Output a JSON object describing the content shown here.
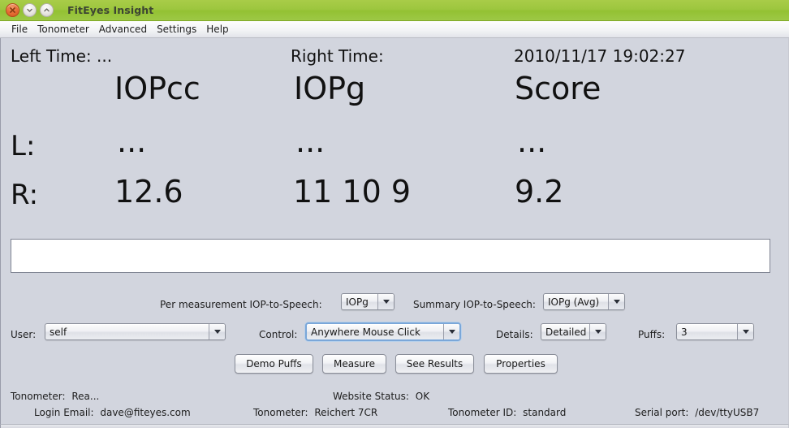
{
  "window": {
    "title": "FitEyes Insight",
    "controls": [
      {
        "name": "close",
        "icon": "close-icon"
      },
      {
        "name": "minimize",
        "icon": "chevron-down-icon"
      },
      {
        "name": "maximize",
        "icon": "chevron-up-icon"
      }
    ],
    "titlebar_color": "#9cc63e"
  },
  "menubar": {
    "items": [
      {
        "label": "File"
      },
      {
        "label": "Tonometer"
      },
      {
        "label": "Advanced"
      },
      {
        "label": "Settings"
      },
      {
        "label": "Help"
      }
    ]
  },
  "readings": {
    "left_time_label": "Left Time:",
    "left_time_value": "...",
    "right_time_label": "Right Time:",
    "right_time_value": "",
    "timestamp": "2010/11/17 19:02:27",
    "columns": [
      {
        "header": "IOPcc"
      },
      {
        "header": "IOPg"
      },
      {
        "header": "Score"
      }
    ],
    "rows": [
      {
        "label": "L:",
        "values": [
          "...",
          "...",
          "..."
        ]
      },
      {
        "label": "R:",
        "values": [
          "12.6",
          "11 10 9",
          "9.2"
        ]
      }
    ]
  },
  "log_field": {
    "value": "",
    "placeholder": ""
  },
  "speech_settings": {
    "per_measurement_label": "Per measurement IOP-to-Speech:",
    "per_measurement_value": "IOPg",
    "summary_label": "Summary IOP-to-Speech:",
    "summary_value": "IOPg (Avg)"
  },
  "controls_row": {
    "user_label": "User:",
    "user_value": "self",
    "control_label": "Control:",
    "control_value": "Anywhere Mouse Click",
    "details_label": "Details:",
    "details_value": "Detailed",
    "puffs_label": "Puffs:",
    "puffs_value": "3"
  },
  "buttons": {
    "demo_puffs": "Demo Puffs",
    "measure": "Measure",
    "see_results": "See Results",
    "properties": "Properties"
  },
  "status": {
    "tonometer_label": "Tonometer:",
    "tonometer_value": "Rea...",
    "website_label": "Website Status:",
    "website_value": "OK"
  },
  "footer": {
    "login_email_label": "Login Email:",
    "login_email_value": "dave@fiteyes.com",
    "tonometer_label": "Tonometer:",
    "tonometer_value": "Reichert 7CR",
    "tonometer_id_label": "Tonometer ID:",
    "tonometer_id_value": "standard",
    "serial_port_label": "Serial port:",
    "serial_port_value": "/dev/ttyUSB7"
  }
}
